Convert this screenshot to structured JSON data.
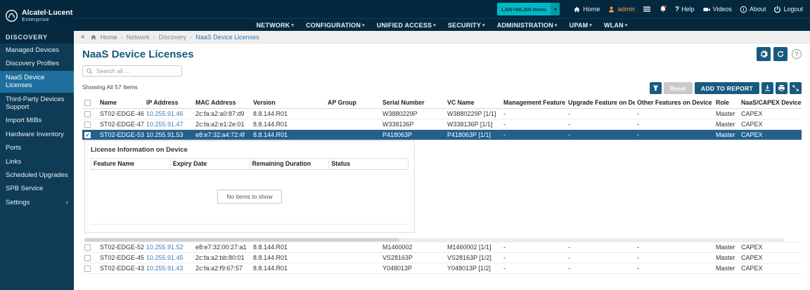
{
  "brand": {
    "name": "Alcatel·Lucent",
    "sub": "Enterprise"
  },
  "topbar": {
    "menu_select": {
      "value": "LAN+WLAN menu"
    },
    "home": "Home",
    "user": "admin",
    "help": "Help",
    "videos": "Videos",
    "about": "About",
    "logout": "Logout"
  },
  "navbar": {
    "items": [
      "NETWORK",
      "CONFIGURATION",
      "UNIFIED ACCESS",
      "SECURITY",
      "ADMINISTRATION",
      "UPAM",
      "WLAN"
    ]
  },
  "sidebar": {
    "title": "DISCOVERY",
    "items": [
      {
        "label": "Managed Devices",
        "active": false,
        "chevron": false
      },
      {
        "label": "Discovery Profiles",
        "active": false,
        "chevron": false
      },
      {
        "label": "NaaS Device Licenses",
        "active": true,
        "chevron": false
      },
      {
        "label": "Third-Party Devices Support",
        "active": false,
        "chevron": false
      },
      {
        "label": "Import MIBs",
        "active": false,
        "chevron": false
      },
      {
        "label": "Hardware Inventory",
        "active": false,
        "chevron": false
      },
      {
        "label": "Ports",
        "active": false,
        "chevron": false
      },
      {
        "label": "Links",
        "active": false,
        "chevron": false
      },
      {
        "label": "Scheduled Upgrades",
        "active": false,
        "chevron": false
      },
      {
        "label": "SPB Service",
        "active": false,
        "chevron": false
      },
      {
        "label": "Settings",
        "active": false,
        "chevron": true
      }
    ]
  },
  "breadcrumb": {
    "items": [
      "Home",
      "Network",
      "Discovery",
      "NaaS Device Licenses"
    ]
  },
  "page": {
    "title": "NaaS Device Licenses"
  },
  "toolbar": {
    "search_placeholder": "Search all ...",
    "showing": "Showing All 57 Items",
    "reset": "Reset",
    "add_to_report": "ADD TO REPORT"
  },
  "table": {
    "columns": [
      "Name",
      "IP Address",
      "MAC Address",
      "Version",
      "AP Group",
      "Serial Number",
      "VC Name",
      "Management Feature on D...",
      "Upgrade Feature on Device",
      "Other Features on Device",
      "Role",
      "NaaS/CAPEX Device"
    ],
    "row_keys": [
      "name",
      "ip",
      "mac",
      "version",
      "ap_group",
      "serial",
      "vc_name",
      "mgmt_feature",
      "upgrade_feature",
      "other_features",
      "role",
      "device_type"
    ],
    "rows": [
      {
        "name": "ST02-EDGE-46",
        "ip": "10.255.91.46",
        "mac": "2c:fa:a2:a0:87:d9",
        "version": "8.8.144.R01",
        "ap_group": "",
        "serial": "W3880229P",
        "vc_name": "W3880229P [1/1]",
        "mgmt_feature": "-",
        "upgrade_feature": "-",
        "other_features": "-",
        "role": "Master",
        "device_type": "CAPEX",
        "selected": false,
        "expanded": false
      },
      {
        "name": "ST02-EDGE-47",
        "ip": "10.255.91.47",
        "mac": "2c:fa:a2:e1:2e:01",
        "version": "8.8.144.R01",
        "ap_group": "",
        "serial": "W338136P",
        "vc_name": "W338136P [1/1]",
        "mgmt_feature": "-",
        "upgrade_feature": "-",
        "other_features": "-",
        "role": "Master",
        "device_type": "CAPEX",
        "selected": false,
        "expanded": false
      },
      {
        "name": "ST02-EDGE-53",
        "ip": "10.255.91.53",
        "mac": "e8:e7:32:a4:72:4f",
        "version": "8.8.144.R01",
        "ap_group": "",
        "serial": "P418063P",
        "vc_name": "P418063P [1/1]",
        "mgmt_feature": "-",
        "upgrade_feature": "-",
        "other_features": "-",
        "role": "Master",
        "device_type": "CAPEX",
        "selected": true,
        "expanded": true
      },
      {
        "name": "ST02-EDGE-52",
        "ip": "10.255.91.52",
        "mac": "e8:e7:32:00:27:a1",
        "version": "8.8.144.R01",
        "ap_group": "",
        "serial": "M1460002",
        "vc_name": "M1460002 [1/1]",
        "mgmt_feature": "-",
        "upgrade_feature": "-",
        "other_features": "-",
        "role": "Master",
        "device_type": "CAPEX",
        "selected": false,
        "expanded": false
      },
      {
        "name": "ST02-EDGE-45",
        "ip": "10.255.91.45",
        "mac": "2c:fa:a2:bb:80:01",
        "version": "8.8.144.R01",
        "ap_group": "",
        "serial": "VS28163P",
        "vc_name": "VS28163P [1/2]",
        "mgmt_feature": "-",
        "upgrade_feature": "-",
        "other_features": "-",
        "role": "Master",
        "device_type": "CAPEX",
        "selected": false,
        "expanded": false
      },
      {
        "name": "ST02-EDGE-43",
        "ip": "10.255.91.43",
        "mac": "2c:fa:a2:f9:67:57",
        "version": "8.8.144.R01",
        "ap_group": "",
        "serial": "Y048013P",
        "vc_name": "Y048013P [1/2]",
        "mgmt_feature": "-",
        "upgrade_feature": "-",
        "other_features": "-",
        "role": "Master",
        "device_type": "CAPEX",
        "selected": false,
        "expanded": false
      }
    ]
  },
  "detail_panel": {
    "title": "License Information on Device",
    "columns": [
      "Feature Name",
      "Expiry Date",
      "Remaining Duration",
      "Status"
    ],
    "empty_text": "No items to show"
  },
  "colors": {
    "topbar_navy": "#04293f",
    "sidebar_navy": "#0e3c57",
    "active_item_blue": "#1e6f9d",
    "selected_row_blue": "#23608c",
    "button_navy": "#1b5a80",
    "teal_accent": "#00b7c3",
    "admin_orange": "#f0a33a",
    "link_blue": "#3a7cbe"
  }
}
